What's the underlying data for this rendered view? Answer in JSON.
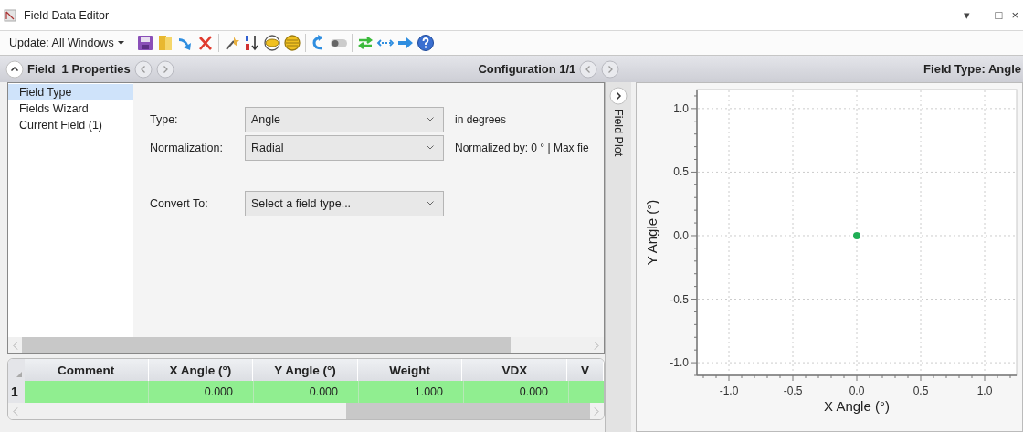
{
  "window": {
    "title": "Field Data Editor",
    "controls": [
      "▾",
      "–",
      "□",
      "×"
    ]
  },
  "toolbar": {
    "update_menu": "Update: All Windows"
  },
  "header": {
    "title": "Field  1 Properties",
    "configuration": "Configuration 1/1",
    "field_type": "Field Type: Angle"
  },
  "sidebar": {
    "items": [
      {
        "label": "Field Type",
        "selected": true
      },
      {
        "label": "Fields Wizard",
        "selected": false
      },
      {
        "label": "Current Field (1)",
        "selected": false
      }
    ]
  },
  "form": {
    "rows": [
      {
        "label": "Type:",
        "value": "Angle",
        "note": "in degrees"
      },
      {
        "label": "Normalization:",
        "value": "Radial",
        "note": "Normalized by: 0 ° | Max fie"
      },
      {
        "label": "Convert To:",
        "placeholder": "Select a field type..."
      }
    ]
  },
  "table": {
    "columns": [
      "Comment",
      "X Angle (°)",
      "Y Angle (°)",
      "Weight",
      "VDX",
      "V"
    ],
    "rows": [
      {
        "number": "1",
        "highlighted": true,
        "cells": [
          "",
          "0.000",
          "0.000",
          "1.000",
          "0.000"
        ]
      }
    ]
  },
  "side_strip": {
    "label": "Field Plot"
  },
  "plot": {
    "chart_data": {
      "type": "scatter",
      "grid": true,
      "xlabel": "X Angle (°)",
      "ylabel": "Y Angle (°)",
      "xlim": [
        -1.25,
        1.25
      ],
      "ylim": [
        -1.1,
        1.15
      ],
      "xticks": [
        {
          "value": -1,
          "label": "-1.0"
        },
        {
          "value": -0.5,
          "label": "-0.5"
        },
        {
          "value": 0,
          "label": "0.0"
        },
        {
          "value": 0.5,
          "label": "0.5"
        },
        {
          "value": 1,
          "label": "1.0"
        }
      ],
      "yticks": [
        {
          "value": -1,
          "label": "-1.0"
        },
        {
          "value": -0.5,
          "label": "-0.5"
        },
        {
          "value": 0,
          "label": "0.0"
        },
        {
          "value": 0.5,
          "label": "0.5"
        },
        {
          "value": 1,
          "label": "1.0"
        }
      ],
      "x": [
        0
      ],
      "series": [
        {
          "color": "#1fae55",
          "values": [
            0
          ]
        }
      ]
    }
  }
}
